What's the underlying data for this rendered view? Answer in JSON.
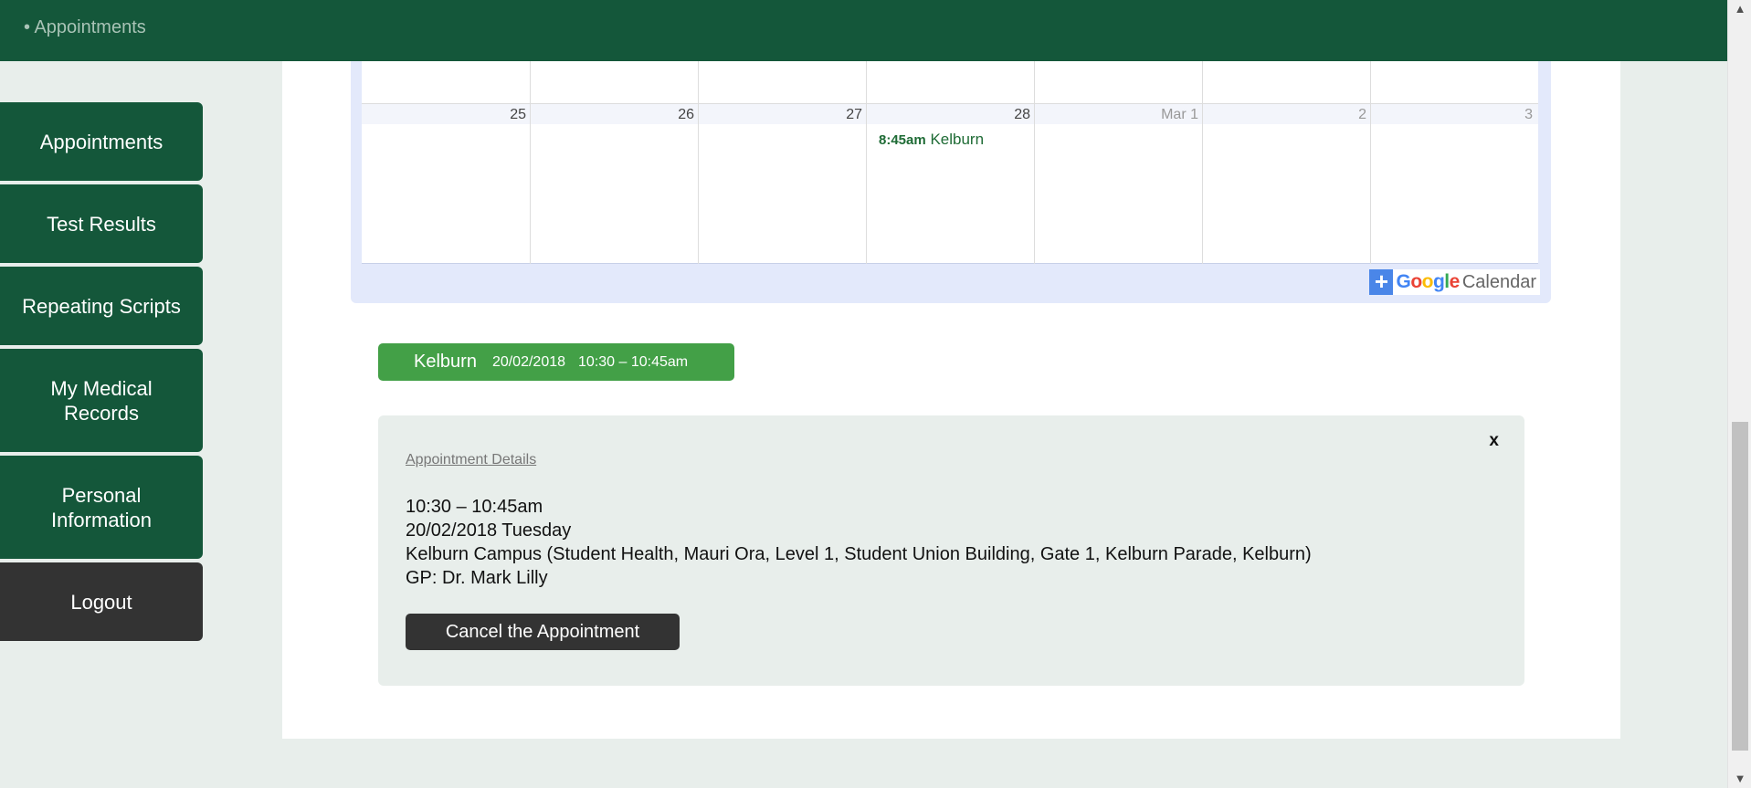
{
  "topbar": {
    "breadcrumb": "• Appointments"
  },
  "sidebar": {
    "items": [
      {
        "label": "Appointments"
      },
      {
        "label": "Test Results"
      },
      {
        "label": "Repeating Scripts"
      },
      {
        "label": "My Medical Records"
      },
      {
        "label": "Personal Information"
      },
      {
        "label": "Logout"
      }
    ]
  },
  "calendar": {
    "days": [
      "25",
      "26",
      "27",
      "28",
      "Mar 1",
      "2",
      "3"
    ],
    "event": {
      "time": "8:45am",
      "title": "Kelburn"
    },
    "google": {
      "g": "Google",
      "cal": "Calendar"
    }
  },
  "appointment": {
    "location": "Kelburn",
    "date": "20/02/2018",
    "time": "10:30 – 10:45am"
  },
  "details": {
    "close": "x",
    "title": "Appointment Details",
    "time_line": "10:30 – 10:45am",
    "date_line": "20/02/2018 Tuesday",
    "location_line": "Kelburn Campus (Student Health, Mauri Ora, Level 1, Student Union Building, Gate 1, Kelburn Parade, Kelburn)",
    "gp_line": "GP: Dr. Mark Lilly",
    "cancel_label": "Cancel the Appointment"
  },
  "colors": {
    "brand_green": "#14573a",
    "pill_green": "#43a047",
    "dark_button": "#333333",
    "google_blue": "#4a86e8"
  }
}
